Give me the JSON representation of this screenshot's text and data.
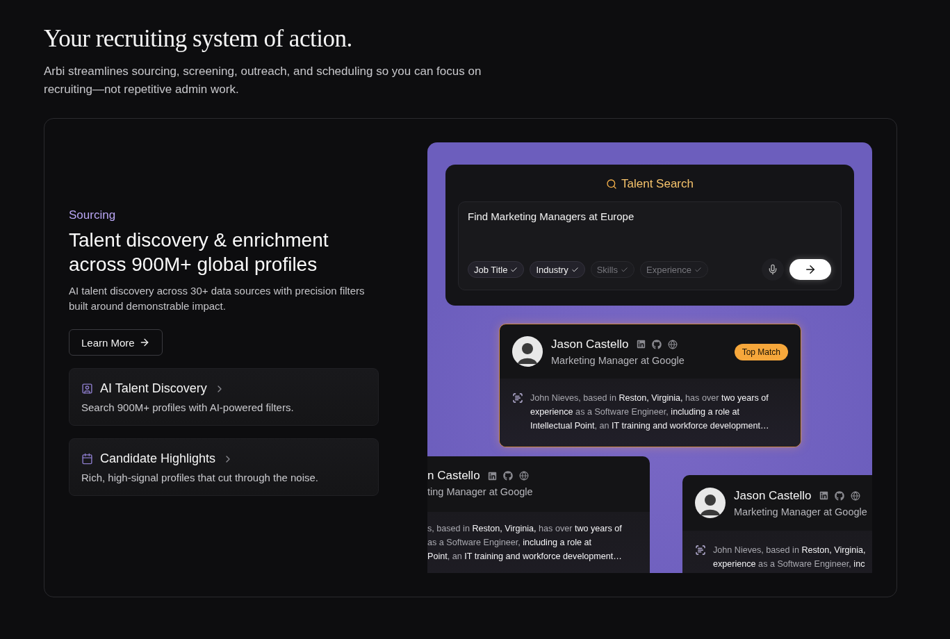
{
  "header": {
    "title": "Your recruiting system of action.",
    "subtitle": "Arbi streamlines sourcing, screening, outreach, and scheduling so you can focus on recruiting—not repetitive admin work."
  },
  "feature": {
    "eyebrow": "Sourcing",
    "title": "Talent discovery & enrichment across 900M+ global profiles",
    "description": "AI talent discovery across 30+ data sources with precision filters built around demonstrable impact.",
    "button": "Learn More",
    "items": [
      {
        "kind": "discovery",
        "title": "AI Talent Discovery",
        "description": "Search 900M+ profiles with AI-powered filters."
      },
      {
        "kind": "highlights",
        "title": "Candidate Highlights",
        "description": "Rich, high-signal profiles that cut through the noise."
      }
    ]
  },
  "demo": {
    "title": "Talent Search",
    "query": "Find Marketing Managers at Europe",
    "filters": [
      {
        "label": "Job Title",
        "selected": true
      },
      {
        "label": "Industry",
        "selected": true
      },
      {
        "label": "Skills",
        "selected": false
      },
      {
        "label": "Experience",
        "selected": false
      }
    ],
    "cards": [
      {
        "kind": "featured",
        "name": "Jason Castello",
        "role": "Marketing Manager at Google",
        "badge": "Top Match",
        "summary": [
          "John Nieves, based in **Reston, Virginia,** has over **two years of**",
          "**experience** as a Software Engineer, **including a role at**",
          "**Intellectual Point**, an **IT training and workforce development…**"
        ]
      },
      {
        "kind": "left",
        "name": "n Castello",
        "role": "ting Manager at Google",
        "summary": [
          "s, based in **Reston, Virginia,** has over **two years of**",
          "as a Software Engineer, **including a role at**",
          "**Point**, an **IT training and workforce development…**"
        ]
      },
      {
        "kind": "right",
        "name": "Jason Castello",
        "role": "Marketing Manager at Google",
        "summary": [
          "John Nieves, based in **Reston, Virginia,**",
          "**experience** as a Software Engineer, **inc**"
        ]
      }
    ]
  }
}
